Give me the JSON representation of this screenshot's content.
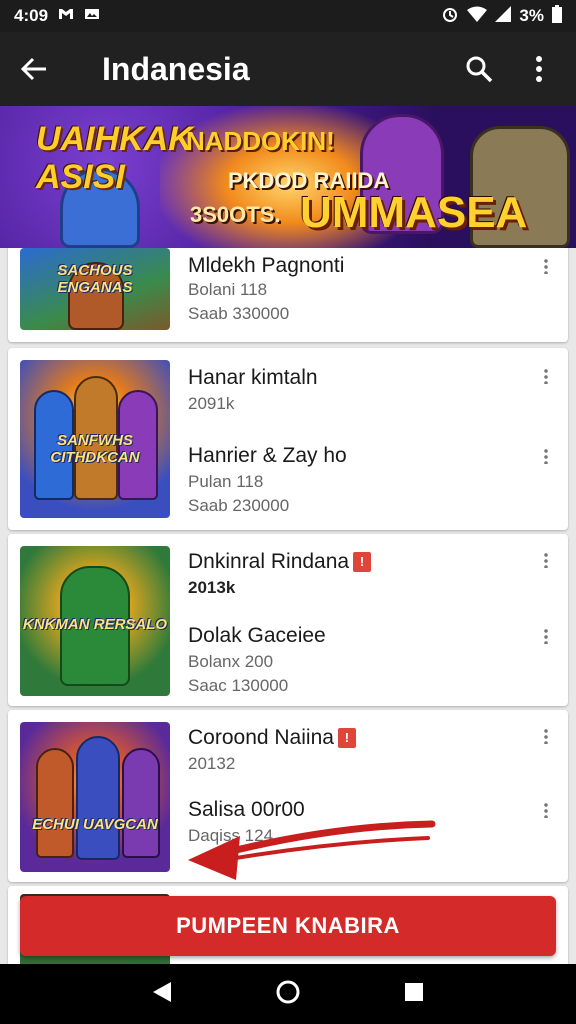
{
  "status_bar": {
    "time": "4:09",
    "battery": "3%"
  },
  "app_bar": {
    "title": "Indanesia",
    "back_icon": "arrow-left-icon",
    "search_icon": "search-icon",
    "menu_icon": "more-vert-icon"
  },
  "banner": {
    "headline_left": "UAIHKAK ASISI",
    "line1": "NADDOKIN!",
    "line2": "PKDOD RAIIDA",
    "line3": "3S0OTS.",
    "big": "UMMASEA"
  },
  "cards": [
    {
      "thumb_caption": "SACHOUS ENGANAS",
      "entries": [
        {
          "title": "Mldekh Pagnonti",
          "sub1": "Bolani 118",
          "sub2": "Saab 330000"
        }
      ]
    },
    {
      "thumb_caption": "SANFWHS CITHDKCAN",
      "entries": [
        {
          "title": "Hanar kimtaln",
          "sub1": "2091k"
        },
        {
          "title": "Hanrier & Zay ho",
          "sub1": "Pulan 118",
          "sub2": "Saab 230000"
        }
      ]
    },
    {
      "thumb_caption": "KNKMAN RERSALO",
      "entries": [
        {
          "title": "Dnkinral Rindana",
          "badge": "!",
          "sub1": "2013k"
        },
        {
          "title": "Dolak Gaceiee",
          "sub1": "Bolanx 200",
          "sub2": "Saac 130000"
        }
      ]
    },
    {
      "thumb_caption": "ECHUI UAVGCAN",
      "entries": [
        {
          "title": "Coroond Naiina",
          "badge": "!",
          "sub1": "20132"
        },
        {
          "title": "Salisa 00r00",
          "sub1": "Daqiss 124"
        }
      ]
    }
  ],
  "cta": {
    "label": "PUMPEEN KNABIRA"
  },
  "colors": {
    "accent": "#d42a2a",
    "appbar": "#212121"
  }
}
